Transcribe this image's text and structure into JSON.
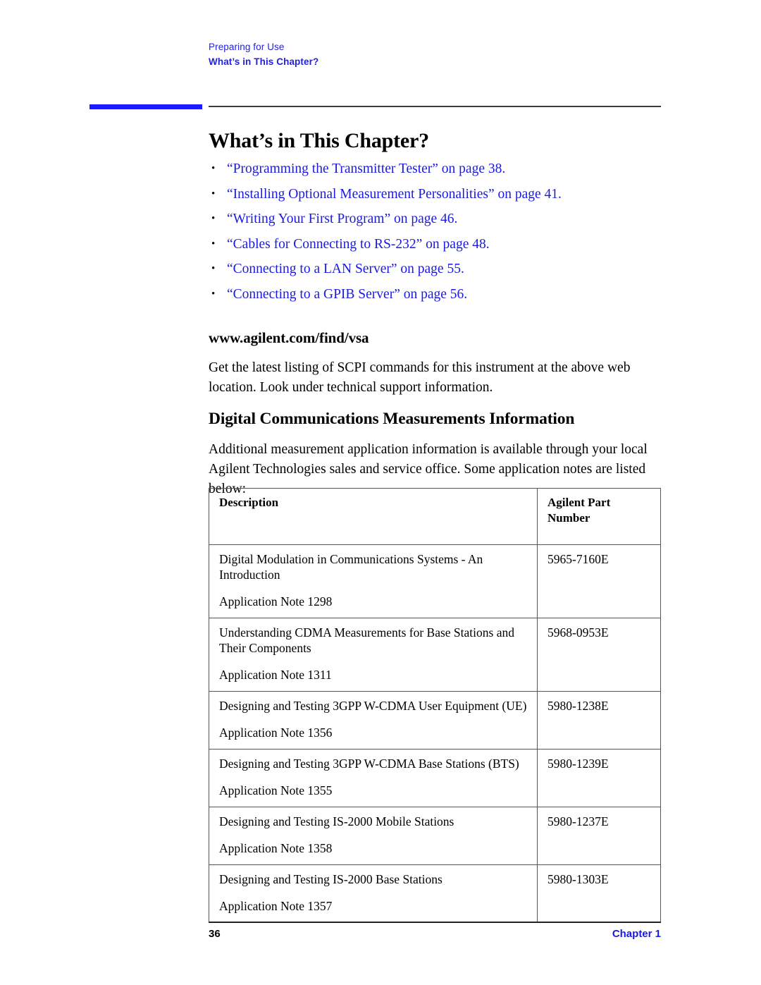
{
  "header": {
    "running_head": "Preparing for Use",
    "running_subhead": "What’s in This Chapter?"
  },
  "title": "What’s in This Chapter?",
  "link_list": [
    {
      "bullet": "•",
      "text": "“Programming the Transmitter Tester” on page  38."
    },
    {
      "bullet": "•",
      "text": "“Installing Optional Measurement Personalities” on page  41."
    },
    {
      "bullet": "•",
      "text": "“Writing Your First Program” on page  46."
    },
    {
      "bullet": "•",
      "text": "“Cables for Connecting to RS-232” on page  48."
    },
    {
      "bullet": "•",
      "text": "“Connecting to a LAN Server” on page  55."
    },
    {
      "bullet": "•",
      "text": "“Connecting to a GPIB Server” on page  56."
    }
  ],
  "www_section": {
    "heading": "www.agilent.com/find/vsa",
    "body": "Get the latest listing of SCPI commands for this instrument at the above web location. Look under technical support information."
  },
  "digital_section": {
    "heading": "Digital Communications Measurements Information",
    "body": "Additional measurement application information is available through your local Agilent Technologies sales and service office. Some application notes are listed below:"
  },
  "table": {
    "columns": [
      "Description",
      "Agilent Part Number"
    ],
    "column_header_desc": "Description",
    "column_header_part_line1": "Agilent Part",
    "column_header_part_line2": "Number",
    "rows": [
      {
        "description": "Digital Modulation in Communications Systems - An Introduction",
        "note": "Application Note 1298",
        "part_number": "5965-7160E"
      },
      {
        "description": "Understanding CDMA Measurements for Base Stations and Their Components",
        "note": "Application Note 1311",
        "part_number": "5968-0953E"
      },
      {
        "description": "Designing and Testing 3GPP W-CDMA User Equipment (UE)",
        "note": "Application Note 1356",
        "part_number": "5980-1238E"
      },
      {
        "description": "Designing and Testing 3GPP W-CDMA Base Stations (BTS)",
        "note": "Application Note 1355",
        "part_number": "5980-1239E"
      },
      {
        "description": "Designing and Testing IS-2000 Mobile Stations",
        "note": "Application Note 1358",
        "part_number": "5980-1237E"
      },
      {
        "description": "Designing and Testing IS-2000 Base Stations",
        "note": "Application Note 1357",
        "part_number": "5980-1303E"
      }
    ]
  },
  "footer": {
    "page_number": "36",
    "chapter": "Chapter 1"
  },
  "colors": {
    "link_blue": "#1a1ae0",
    "header_blue": "#2222dd",
    "tab_blue": "#1a1aff",
    "rule_gray": "#3a3a3a",
    "table_border": "#555555"
  }
}
